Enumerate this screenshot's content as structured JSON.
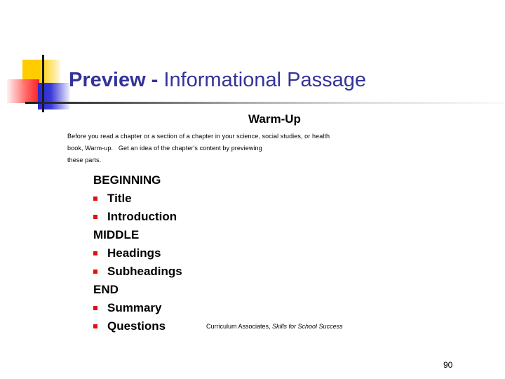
{
  "slide": {
    "title_bold": "Preview -",
    "title_rest": " Informational Passage",
    "subtitle": "Warm-Up",
    "intro_lines": [
      "Before you read a chapter or a section of a chapter in your science, social studies, or health",
      "book, Warm-up.   Get an idea of the chapter's content by previewing",
      "these parts."
    ],
    "outline": [
      {
        "type": "heading",
        "text": "BEGINNING"
      },
      {
        "type": "item",
        "text": "Title"
      },
      {
        "type": "item",
        "text": "Introduction"
      },
      {
        "type": "heading",
        "text": "MIDDLE"
      },
      {
        "type": "item",
        "text": "Headings"
      },
      {
        "type": "item",
        "text": "Subheadings"
      },
      {
        "type": "heading",
        "text": "END"
      },
      {
        "type": "item",
        "text": "Summary"
      },
      {
        "type": "item",
        "text": "Questions"
      }
    ],
    "credit_plain": "Curriculum Associates, ",
    "credit_italic": "Skills for School Success",
    "page_number": "90"
  },
  "colors": {
    "title": "#333399",
    "bullet": "#e01010",
    "logo_yellow": "#ffcc00",
    "logo_red": "#ff2020",
    "logo_blue": "#2a2ad0"
  }
}
